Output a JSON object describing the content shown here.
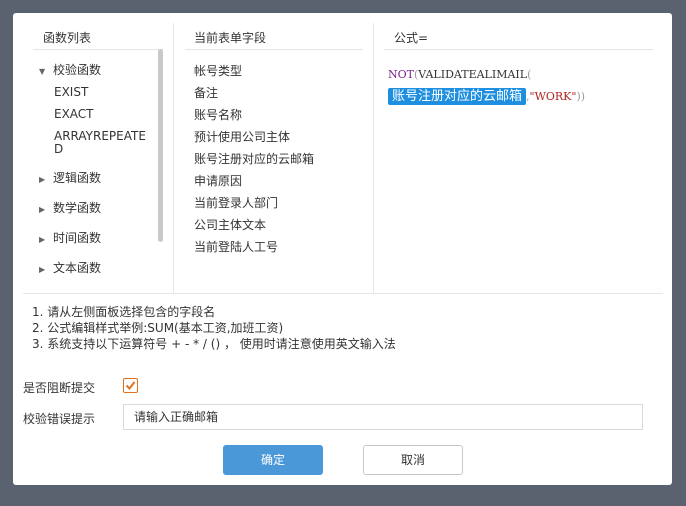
{
  "panels": {
    "functions_title": "函数列表",
    "fields_title": "当前表单字段",
    "formula_title": "公式="
  },
  "function_tree": {
    "validation": {
      "label": "校验函数",
      "expanded": true,
      "children": [
        "EXIST",
        "EXACT",
        "ARRAYREPEATE",
        "D"
      ]
    },
    "collapsed": [
      "逻辑函数",
      "数学函数",
      "时间函数",
      "文本函数"
    ]
  },
  "fields": [
    "帐号类型",
    "备注",
    "账号名称",
    "预计使用公司主体",
    "账号注册对应的云邮箱",
    "申请原因",
    "当前登录人部门",
    "公司主体文本",
    "当前登陆人工号"
  ],
  "formula": {
    "not": "NOT",
    "open1": "(",
    "fn": "VALIDATEALIMAIL",
    "open2": "(",
    "field": "账号注册对应的云邮箱",
    "comma": ",",
    "str": "\"WORK\"",
    "close": "))"
  },
  "hints": [
    "1. 请从左侧面板选择包含的字段名",
    "2. 公式编辑样式举例:SUM(基本工资,加班工资)",
    "3. 系统支持以下运算符号 + - * / () ， 使用时请注意使用英文输入法"
  ],
  "form": {
    "block_submit_label": "是否阻断提交",
    "block_submit_checked": true,
    "error_hint_label": "校验错误提示",
    "error_hint_value": "请输入正确邮箱"
  },
  "buttons": {
    "confirm": "确定",
    "cancel": "取消"
  },
  "colors": {
    "primary": "#4b98d8",
    "checkbox": "#e0701f",
    "field_tag": "#1e8fe0",
    "keyword": "#7a1f8c",
    "string": "#b22222"
  }
}
